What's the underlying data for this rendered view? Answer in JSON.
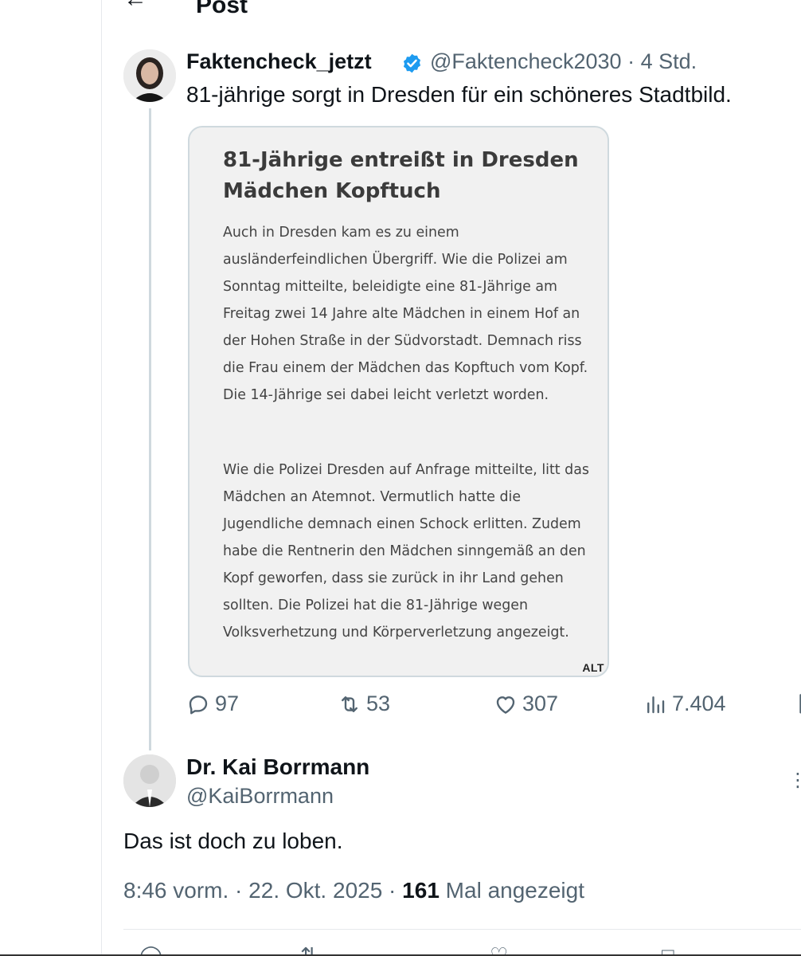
{
  "header": {
    "title": "Post",
    "back_icon": "arrow-left-icon"
  },
  "tweet": {
    "author_name": "Faktencheck_jetzt",
    "verified_color": "#1d9bf0",
    "handle": "@Faktencheck2030",
    "separator": "·",
    "time": "4 Std.",
    "text": "81-jährige sorgt in Dresden für ein schöneres Stadtbild.",
    "media": {
      "title": "81-Jährige entreißt in Dresden Mädchen Kopftuch",
      "paragraph1": "Auch in Dresden kam es zu einem ausländerfeindlichen Übergriff. Wie die Polizei am Sonntag mitteilte, beleidigte eine 81-Jährige am Freitag zwei 14 Jahre alte Mädchen in einem Hof an der Hohen Straße in der Südvorstadt. Demnach riss die Frau einem der Mädchen das Kopftuch vom Kopf. Die 14-Jährige sei dabei leicht verletzt worden.",
      "paragraph2": "Wie die Polizei Dresden auf Anfrage mitteilte, litt das Mädchen an Atemnot. Vermutlich hatte die Jugendliche demnach einen Schock erlitten. Zudem habe die Rentnerin den Mädchen sinngemäß an den Kopf geworfen, dass sie zurück in ihr Land gehen sollten. Die Polizei hat die 81-Jährige wegen Volksverhetzung und Körperverletzung angezeigt.",
      "alt_badge": "ALT"
    },
    "stats": {
      "replies": "97",
      "retweets": "53",
      "likes": "307",
      "views": "7.404"
    }
  },
  "reply": {
    "author_name": "Dr. Kai Borrmann",
    "handle": "@KaiBorrmann",
    "text": "Das ist doch zu loben.",
    "time": "8:46 vorm.",
    "date": "22. Okt. 2025",
    "views_count": "161",
    "views_label": "Mal angezeigt"
  },
  "colors": {
    "accent": "#1d9bf0",
    "secondary_text": "#536471",
    "border": "#cfd9de"
  }
}
